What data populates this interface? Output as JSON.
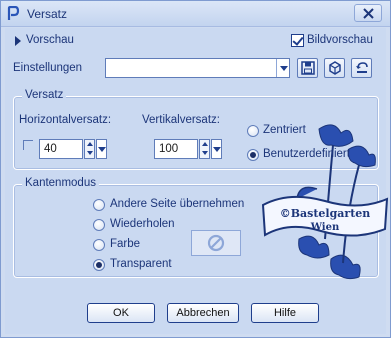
{
  "window": {
    "title": "Versatz"
  },
  "top": {
    "preview_label": "Vorschau",
    "bildvorschau_label": "Bildvorschau",
    "bildvorschau_checked": true
  },
  "einstellungen": {
    "label": "Einstellungen",
    "value": ""
  },
  "versatz": {
    "group_title": "Versatz",
    "horizontal_label": "Horizontalversatz:",
    "vertical_label": "Vertikalversatz:",
    "horizontal_value": "40",
    "vertical_value": "100",
    "options": [
      {
        "label": "Zentriert",
        "selected": false
      },
      {
        "label": "Benutzerdefiniert",
        "selected": true
      }
    ]
  },
  "kantenmodus": {
    "group_title": "Kantenmodus",
    "options": [
      {
        "label": "Andere Seite übernehmen",
        "selected": false
      },
      {
        "label": "Wiederholen",
        "selected": false
      },
      {
        "label": "Farbe",
        "selected": false
      },
      {
        "label": "Transparent",
        "selected": true
      }
    ]
  },
  "buttons": {
    "ok": "OK",
    "cancel": "Abbrechen",
    "help": "Hilfe"
  },
  "watermark": {
    "line1": "©Bastelgarten",
    "line2": "Wien"
  },
  "colors": {
    "accent": "#1f3e8c",
    "background": "#cad9f1",
    "watermark": "#2a4fb0"
  },
  "icons": [
    "app-icon",
    "close-icon",
    "save-icon",
    "delete-preset-icon",
    "reset-icon",
    "no-color-icon"
  ]
}
